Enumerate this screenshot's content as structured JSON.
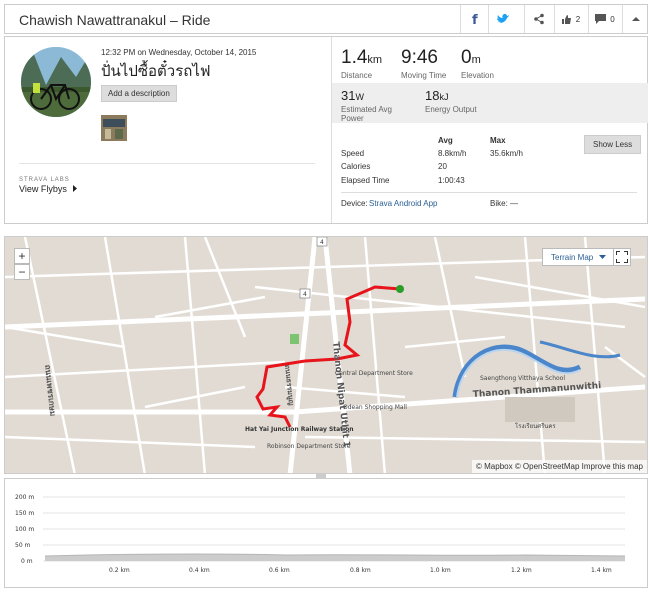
{
  "header": {
    "title": "Chawish Nawattranakul – Ride",
    "kudos_count": "2",
    "comment_count": "0"
  },
  "activity": {
    "time": "12:32 PM on Wednesday, October 14, 2015",
    "name": "ปั่นไปซื้อตั๋วรถไฟ",
    "add_description": "Add a description",
    "strava_labs": "STRAVA LABS",
    "view_flybys": "View Flybys"
  },
  "stats": {
    "distance": {
      "value": "1.4",
      "unit": "km",
      "label": "Distance"
    },
    "moving_time": {
      "value": "9:46",
      "label": "Moving Time"
    },
    "elevation": {
      "value": "0",
      "unit": "m",
      "label": "Elevation"
    },
    "power": {
      "value": "31",
      "unit": "W",
      "label": "Estimated Avg Power"
    },
    "energy": {
      "value": "18",
      "unit": "kJ",
      "label": "Energy Output"
    }
  },
  "details": {
    "avg_header": "Avg",
    "max_header": "Max",
    "show_less": "Show Less",
    "speed_label": "Speed",
    "speed_avg": "8.8km/h",
    "speed_max": "35.6km/h",
    "calories_label": "Calories",
    "calories_value": "20",
    "elapsed_label": "Elapsed Time",
    "elapsed_value": "1:00:43",
    "device_label": "Device:",
    "device_value": "Strava Android App",
    "bike_label": "Bike:",
    "bike_value": "—"
  },
  "map": {
    "terrain_label": "Terrain Map",
    "attribution": "© Mapbox © OpenStreetMap Improve this map",
    "zoom_in": "+",
    "zoom_out": "−",
    "labels": {
      "central": "Central Department Store",
      "odean": "Odean Shopping Mall",
      "robinson": "Robinson Department Store",
      "railway": "Hat Yai Junction Railway Station",
      "nipat": "Thanon Nipat Uthit 1",
      "thamma": "Thanon Thammanunwithi",
      "saengthong": "Saengthong Vitthaya School",
      "thai_school": "โรงเรียนศรีนคร",
      "road_4": "4",
      "thai_road": "ถนนเพชรเกษม",
      "thai_road2": "ถนนธรรมนูญ"
    },
    "route_color": "#e8141b",
    "end_color": "#2a9d2a"
  },
  "elevation_chart": {
    "y_ticks": [
      "200 m",
      "150 m",
      "100 m",
      "50 m",
      "0 m"
    ],
    "x_ticks": [
      "0.2 km",
      "0.4 km",
      "0.6 km",
      "0.8 km",
      "1.0 km",
      "1.2 km",
      "1.4 km"
    ]
  }
}
